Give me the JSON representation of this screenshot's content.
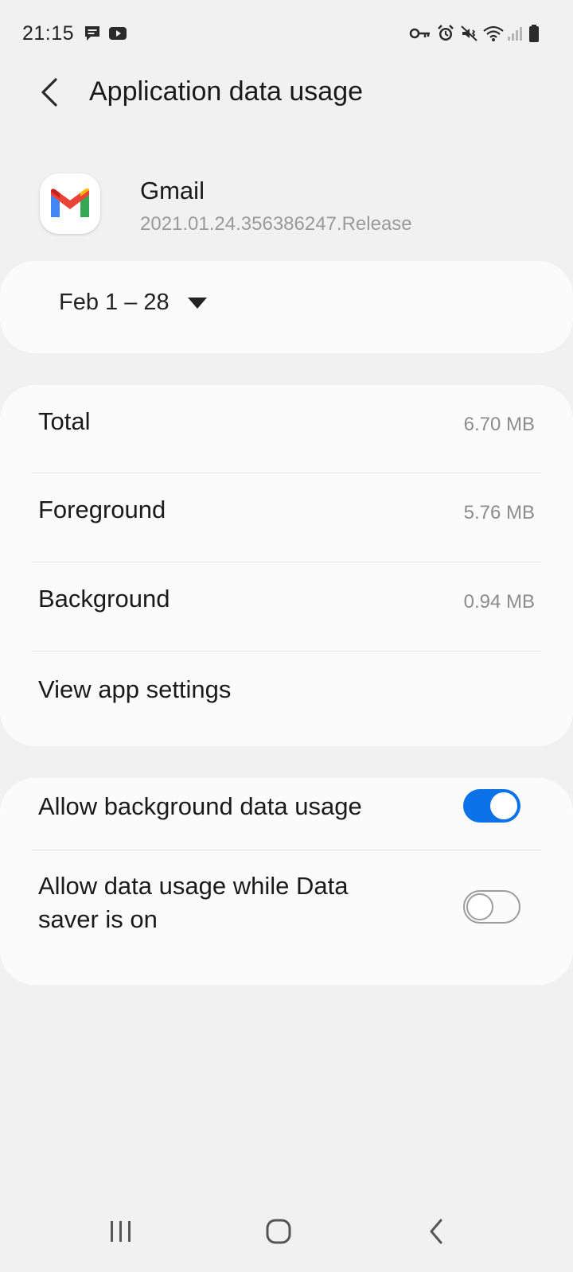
{
  "status_bar": {
    "time": "21:15",
    "left_icons": [
      "message-icon",
      "youtube-icon"
    ],
    "right_icons": [
      "vpn-key-icon",
      "alarm-icon",
      "vibrate-icon",
      "wifi-icon",
      "signal-icon",
      "battery-icon"
    ]
  },
  "header": {
    "title": "Application data usage",
    "back_icon": "chevron-left-icon"
  },
  "app": {
    "name": "Gmail",
    "version": "2021.01.24.356386247.Release",
    "icon": "gmail-icon"
  },
  "date_range": {
    "label": "Feb 1 – 28",
    "icon": "dropdown-triangle-icon"
  },
  "usage": [
    {
      "label": "Total",
      "value": "6.70 MB"
    },
    {
      "label": "Foreground",
      "value": "5.76 MB"
    },
    {
      "label": "Background",
      "value": "0.94 MB"
    }
  ],
  "view_app_settings": "View app settings",
  "settings": [
    {
      "label": "Allow background data usage",
      "enabled": true
    },
    {
      "label": "Allow data usage while Data saver is on",
      "enabled": false
    }
  ],
  "navbar": {
    "icons": [
      "recents-icon",
      "home-icon",
      "back-icon"
    ]
  },
  "colors": {
    "background": "#f1f1f1",
    "card": "#fbfbfb",
    "accent": "#0b72e7",
    "secondary_text": "#8c8c8c"
  }
}
